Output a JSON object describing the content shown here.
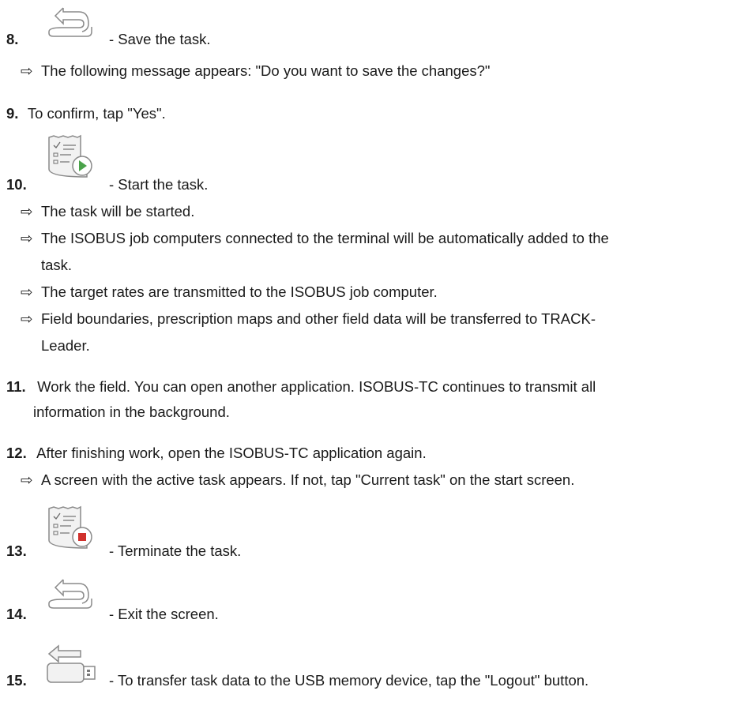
{
  "steps": [
    {
      "num": "8.",
      "icon": "back-arrow-icon",
      "text": "- Save the task.",
      "results": [
        "The following message appears: \"Do you want to save the changes?\""
      ]
    },
    {
      "num": "9.",
      "text": "To confirm, tap \"Yes\"."
    },
    {
      "num": "10.",
      "icon": "start-task-icon",
      "text": "- Start the task.",
      "results": [
        "The task will be started.",
        "The ISOBUS job computers connected to the terminal will be automatically added to the",
        "task.",
        "The target rates are transmitted to the ISOBUS job computer.",
        "Field boundaries, prescription maps and other field data will be transferred to TRACK-",
        "Leader."
      ]
    },
    {
      "num": "11.",
      "text": "Work the field. You can open another application. ISOBUS-TC continues to transmit all",
      "text2": "information in the background."
    },
    {
      "num": "12.",
      "text": "After finishing work, open the ISOBUS-TC application again.",
      "results": [
        "A screen with the active task appears. If not, tap \"Current task\" on the start screen."
      ]
    },
    {
      "num": "13.",
      "icon": "terminate-task-icon",
      "text": "- Terminate the task."
    },
    {
      "num": "14.",
      "icon": "back-arrow-icon",
      "text": "- Exit the screen."
    },
    {
      "num": "15.",
      "icon": "usb-logout-icon",
      "text": "- To transfer task data to the USB memory device, tap the \"Logout\" button."
    }
  ],
  "result_marker": "⇨",
  "colors": {
    "text": "#1a1a1a",
    "icon_stroke": "#8a8a8a",
    "play_green": "#4aa34a",
    "stop_red": "#d0312d"
  }
}
